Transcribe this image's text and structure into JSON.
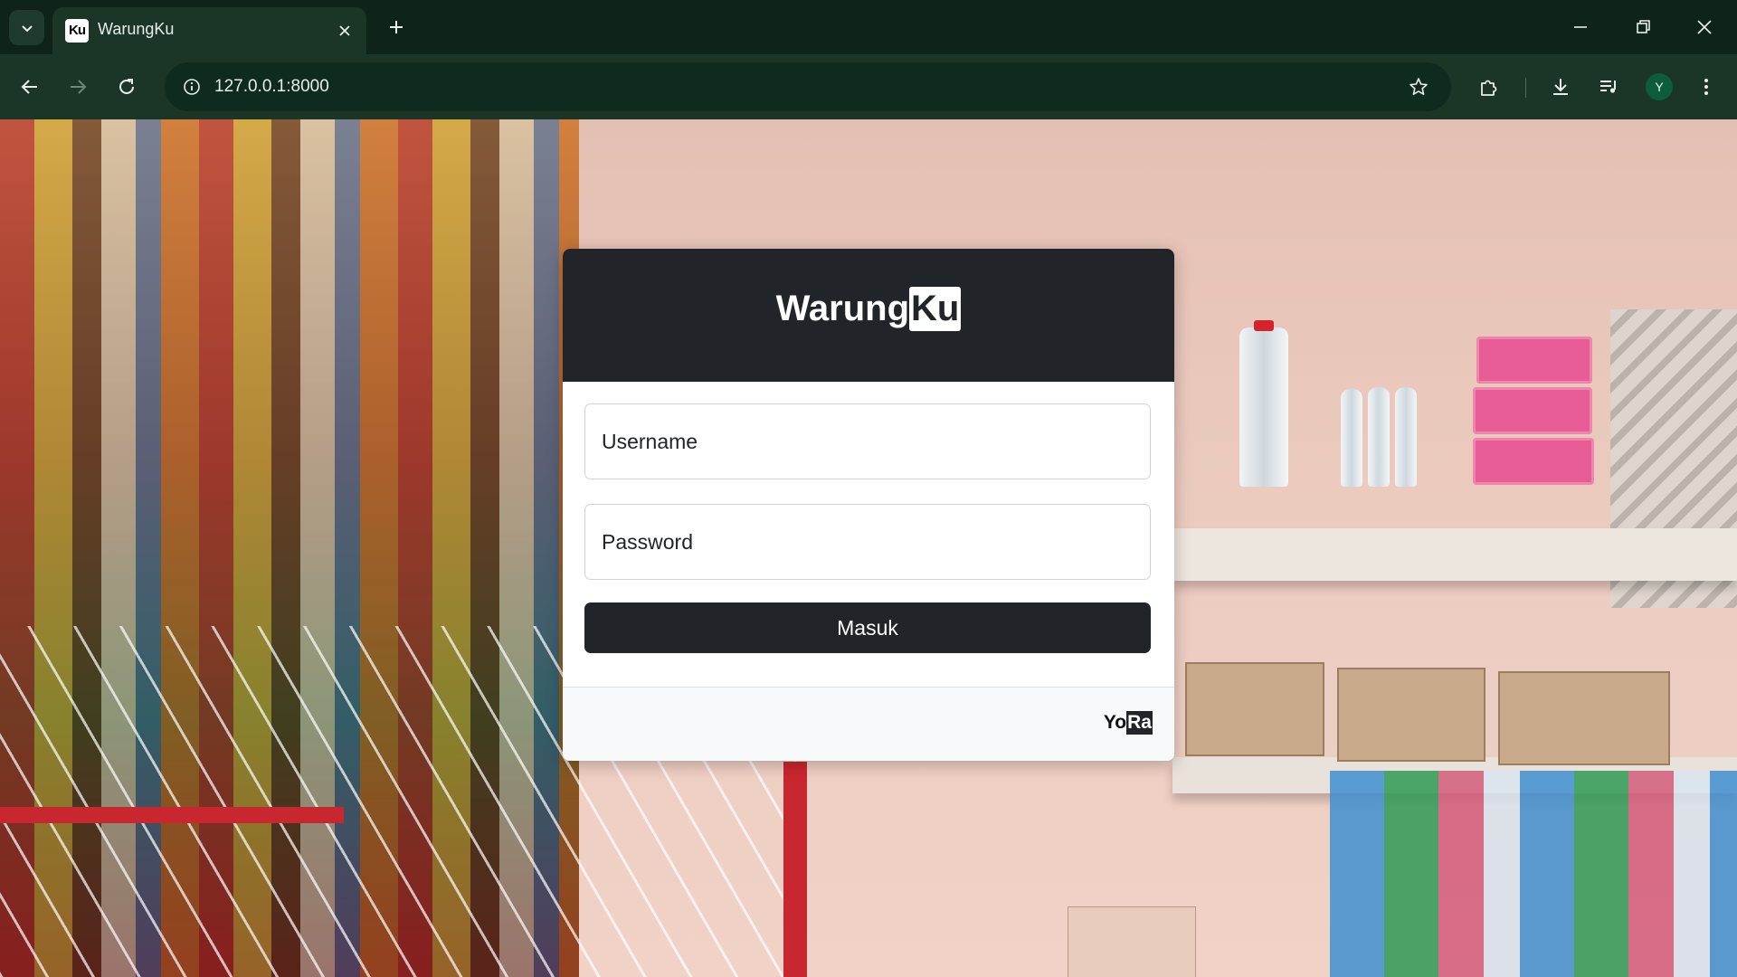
{
  "browser": {
    "tab_title": "WarungKu",
    "favicon_text": "Ku",
    "url": "127.0.0.1:8000",
    "profile_initial": "Y",
    "icons": {
      "tab_dropdown": "chevron-down-icon",
      "tab_close": "close-icon",
      "new_tab": "plus-icon",
      "minimize": "minimize-icon",
      "restore": "restore-icon",
      "close_window": "close-icon",
      "back": "arrow-left-icon",
      "forward": "arrow-right-icon",
      "reload": "reload-icon",
      "site_info": "info-icon",
      "bookmark": "star-icon",
      "extensions": "puzzle-icon",
      "downloads": "download-icon",
      "media": "media-queue-icon",
      "menu": "kebab-menu-icon"
    },
    "colors": {
      "frame": "#0e2419",
      "toolbar": "#1b3527",
      "omnibox": "#0f2a1e"
    }
  },
  "login": {
    "brand_prefix": "Warung",
    "brand_highlight": "Ku",
    "username_placeholder": "Username",
    "password_placeholder": "Password",
    "submit_label": "Masuk",
    "footer_prefix": "Yo",
    "footer_highlight": "Ra",
    "colors": {
      "dark": "#212529",
      "footer_bg": "#f8f9fa"
    }
  }
}
